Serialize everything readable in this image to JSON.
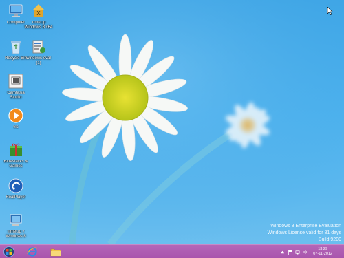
{
  "desktop": {
    "icons": [
      {
        "label": "Computer",
        "icon": "computer-icon"
      },
      {
        "label": "TimeUp Windows 8 x64",
        "icon": "timeup-icon"
      },
      {
        "label": "Recycle Bin",
        "icon": "recycle-bin-icon"
      },
      {
        "label": "windows eval (1)",
        "icon": "system-tool-icon"
      },
      {
        "label": "Camtasia Studio",
        "icon": "camtasia-icon"
      },
      {
        "label": "vlc",
        "icon": "media-player-icon"
      },
      {
        "label": "Bluestacks & Games",
        "icon": "bluestacks-icon"
      },
      {
        "label": "RealPlayer",
        "icon": "realplayer-icon"
      },
      {
        "label": "TimeUp 7 Windows 8",
        "icon": "timeup-setup-icon"
      }
    ]
  },
  "watermark": {
    "line1": "Windows 8 Enterprise Evaluation",
    "line2": "Windows License valid for 81 days",
    "line3": "Build 9200"
  },
  "taskbar": {
    "pinned": [
      {
        "name": "start",
        "icon": "windows-start-icon"
      },
      {
        "name": "internet-explorer",
        "icon": "internet-explorer-icon"
      },
      {
        "name": "file-explorer",
        "icon": "folder-icon"
      }
    ],
    "tray": {
      "icons": [
        "show-hidden-icons-icon",
        "flag-icon",
        "network-icon",
        "volume-icon"
      ],
      "time": "13:29",
      "date": "07-11-2012"
    }
  },
  "colors": {
    "taskbar": "#a955ad",
    "desktop_sky": "#4db2ee"
  }
}
